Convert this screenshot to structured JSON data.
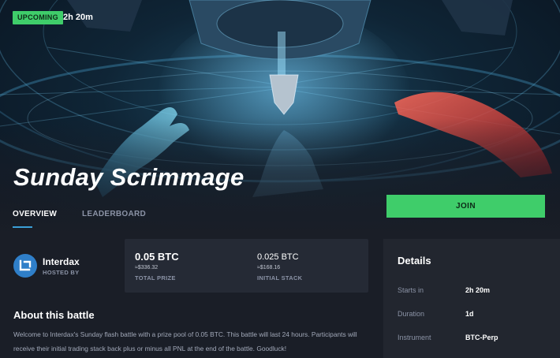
{
  "status_badge": "UPCOMING",
  "countdown": "2h 20m",
  "battle_title": "Sunday Scrimmage",
  "tabs": [
    {
      "label": "OVERVIEW",
      "active": true
    },
    {
      "label": "LEADERBOARD",
      "active": false
    }
  ],
  "join_label": "JOIN",
  "host": {
    "name": "Interdax",
    "label": "HOSTED BY",
    "logo_icon": "interdax-logo-icon"
  },
  "stats": {
    "total_prize": {
      "value": "0.05 BTC",
      "usd": "≈$336.32",
      "label": "TOTAL PRIZE"
    },
    "initial_stack": {
      "value": "0.025 BTC",
      "usd": "≈$168.16",
      "label": "INITIAL STACK"
    }
  },
  "about": {
    "title": "About this battle",
    "text": "Welcome to Interdax's Sunday flash battle with a prize pool of 0.05 BTC. This battle will last 24 hours. Participants will receive their initial trading stack back plus or minus all PNL at the end of the battle. Goodluck!"
  },
  "details": {
    "title": "Details",
    "rows": [
      {
        "key": "Starts in",
        "value": "2h 20m"
      },
      {
        "key": "Duration",
        "value": "1d"
      },
      {
        "key": "Instrument",
        "value": "BTC-Perp"
      }
    ]
  },
  "colors": {
    "accent_green": "#3fcd6a",
    "tab_underline": "#3b9fd8",
    "background": "#1a1e27",
    "card": "#252a35",
    "panel": "#22262f"
  }
}
